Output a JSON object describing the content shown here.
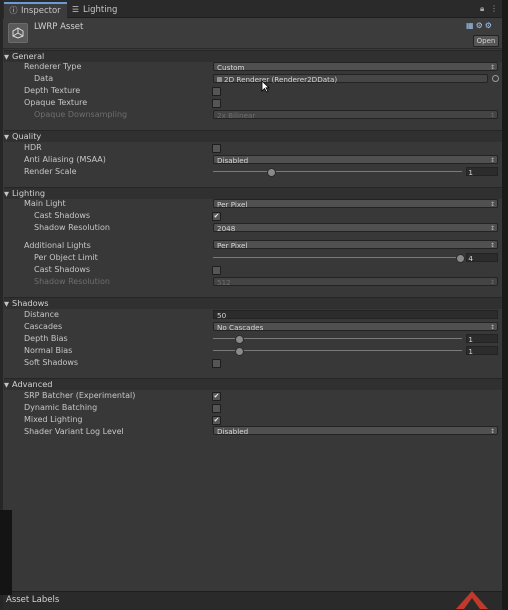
{
  "tabs": {
    "inspector": "Inspector",
    "lighting": "Lighting",
    "inspector_icon": "info-icon",
    "lighting_icon": "list-icon"
  },
  "header": {
    "asset_title": "LWRP Asset",
    "open_label": "Open",
    "asset_icon": "unity-icon"
  },
  "sections": {
    "general": "General",
    "quality": "Quality",
    "lighting": "Lighting",
    "shadows": "Shadows",
    "advanced": "Advanced"
  },
  "general": {
    "renderer_type_label": "Renderer Type",
    "renderer_type_value": "Custom",
    "data_label": "Data",
    "data_value": "2D Renderer (Renderer2DData)",
    "depth_texture_label": "Depth Texture",
    "depth_texture_checked": false,
    "opaque_texture_label": "Opaque Texture",
    "opaque_texture_checked": false,
    "opaque_downsampling_label": "Opaque Downsampling",
    "opaque_downsampling_value": "2x Bilinear"
  },
  "quality": {
    "hdr_label": "HDR",
    "hdr_checked": false,
    "msaa_label": "Anti Aliasing (MSAA)",
    "msaa_value": "Disabled",
    "render_scale_label": "Render Scale",
    "render_scale_value": "1"
  },
  "lighting": {
    "main_light_label": "Main Light",
    "main_light_value": "Per Pixel",
    "cast_shadows_label": "Cast Shadows",
    "cast_shadows_checked": true,
    "shadow_resolution_label": "Shadow Resolution",
    "shadow_resolution_value": "2048",
    "additional_lights_label": "Additional Lights",
    "additional_lights_value": "Per Pixel",
    "per_object_limit_label": "Per Object Limit",
    "per_object_limit_value": "4",
    "add_cast_shadows_label": "Cast Shadows",
    "add_cast_shadows_checked": false,
    "add_shadow_resolution_label": "Shadow Resolution",
    "add_shadow_resolution_value": "512"
  },
  "shadows": {
    "distance_label": "Distance",
    "distance_value": "50",
    "cascades_label": "Cascades",
    "cascades_value": "No Cascades",
    "depth_bias_label": "Depth Bias",
    "depth_bias_value": "1",
    "normal_bias_label": "Normal Bias",
    "normal_bias_value": "1",
    "soft_shadows_label": "Soft Shadows",
    "soft_shadows_checked": false
  },
  "advanced": {
    "srp_batcher_label": "SRP Batcher (Experimental)",
    "srp_batcher_checked": true,
    "dynamic_batching_label": "Dynamic Batching",
    "dynamic_batching_checked": false,
    "mixed_lighting_label": "Mixed Lighting",
    "mixed_lighting_checked": true,
    "shader_log_label": "Shader Variant Log Level",
    "shader_log_value": "Disabled"
  },
  "footer": {
    "asset_labels": "Asset Labels"
  },
  "colors": {
    "panel_bg": "#383838",
    "section_bg": "#303030",
    "dropdown_bg": "#505050",
    "accent": "#6a9bd8"
  }
}
